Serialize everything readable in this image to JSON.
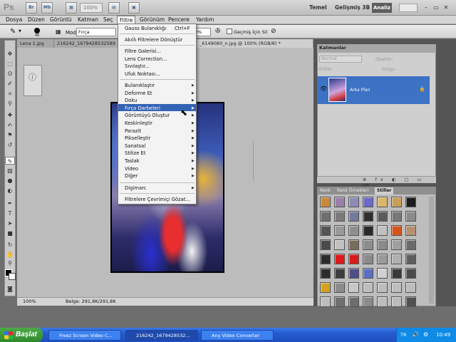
{
  "app": {
    "logo": "Ps",
    "toolbar_btns": [
      "Br",
      "Mb"
    ],
    "zoom": "100%"
  },
  "workspace": {
    "temel": "Temel",
    "gelismis": "Gelişmiş 3B",
    "analiz": "Analiz"
  },
  "window_ctrls": [
    "–",
    "▭",
    "✕"
  ],
  "menubar": [
    "Dosya",
    "Düzen",
    "Görüntü",
    "Katman",
    "Seç",
    "Filtre",
    "Görünüm",
    "Pencere",
    "Yardım"
  ],
  "options": {
    "brush_size": "40",
    "mode_label": "Mod:",
    "mode_value": "Fırça",
    "opacity": "0%",
    "history_label": "Geçmiş İçin Sil"
  },
  "doc_tabs": [
    "Lena 1.jpg",
    "216242_1679428532589",
    "_6149080_n.jpg @ 100% (RGB/8) *"
  ],
  "menu": {
    "top": [
      {
        "label": "Gauss Bulanıklığı",
        "shortcut": "Ctrl+F"
      },
      {
        "label": "Akıllı Filtrelere Dönüştür"
      }
    ],
    "gallery": [
      "Filtre Galerisi...",
      "Lens Correction...",
      "Sıvılaştır...",
      "Ufuk Noktası..."
    ],
    "sub": [
      "Bulanıklaştır",
      "Deforme Et",
      "Doku",
      "Fırça Darbeleri",
      "Görüntüyü Oluştur",
      "Keskinleştir",
      "Parazit",
      "Pikselleştir",
      "Sanatsal",
      "Stilize Et",
      "Taslak",
      "Video",
      "Diğer"
    ],
    "digimarc": "Digimarc",
    "browse": "Filtrelere Çevrimiçi Gözat..."
  },
  "layers": {
    "tab": "Katmanlar",
    "blend": "Normal",
    "opacity_label": "Opaklık:",
    "lock_label": "Kilitle:",
    "fill_label": "Dolgu:",
    "layer_name": "Arka Plan",
    "footer": "⊕ fx ◐ ▢ ▭ ⌫"
  },
  "styles": {
    "tabs": [
      "Renk",
      "Renk Örnekleri",
      "Stiller"
    ],
    "swatches": [
      "#c88a3a",
      "#9b7ea9",
      "#8e8ab8",
      "#6b68c6",
      "#d9b66a",
      "#c89f58",
      "#1c1c1c",
      "#6f6f6f",
      "#7a7a7a",
      "#707a9a",
      "#2f2f2f",
      "#5b5b5b",
      "#777777",
      "#8a8a8a",
      "#555555",
      "#9a9a9a",
      "#8f8f8f",
      "#2a2a2a",
      "#c0c0c0",
      "#d4541c",
      "#b89070",
      "#4a4a4a",
      "#c2c2c2",
      "#7a6c5a",
      "#8c8c8c",
      "#8a8a8a",
      "#a0a0a0",
      "#6a6a6a",
      "#2b2b2b",
      "#e01818",
      "#d91b1b",
      "#8a8a8a",
      "#9a9a9a",
      "#b0b0b0",
      "#5e5e5e",
      "#2c2c2c",
      "#3d3d3d",
      "#4d4d88",
      "#5b6ec0",
      "#d0d0d0",
      "#3a3a3a",
      "#4a4a4a",
      "#d4a020",
      "#8b8b8b",
      "#c8c8c8",
      "#bdbdbd",
      "#bdbdbd",
      "#bdbdbd",
      "#bdbdbd",
      "#bdbdbd",
      "#707070",
      "#6e6e6e",
      "#8a8a8a",
      "#bdbdbd",
      "#bdbdbd",
      "#505050"
    ]
  },
  "status": {
    "zoom": "100%",
    "doc": "Belge: 291,8K/291,8K"
  },
  "taskbar": {
    "start": "Başlat",
    "tasks": [
      "Freez Screen Video C...",
      "216242_1679428532...",
      "Any Video Converter"
    ],
    "lang": "TR",
    "time": "10:49"
  }
}
